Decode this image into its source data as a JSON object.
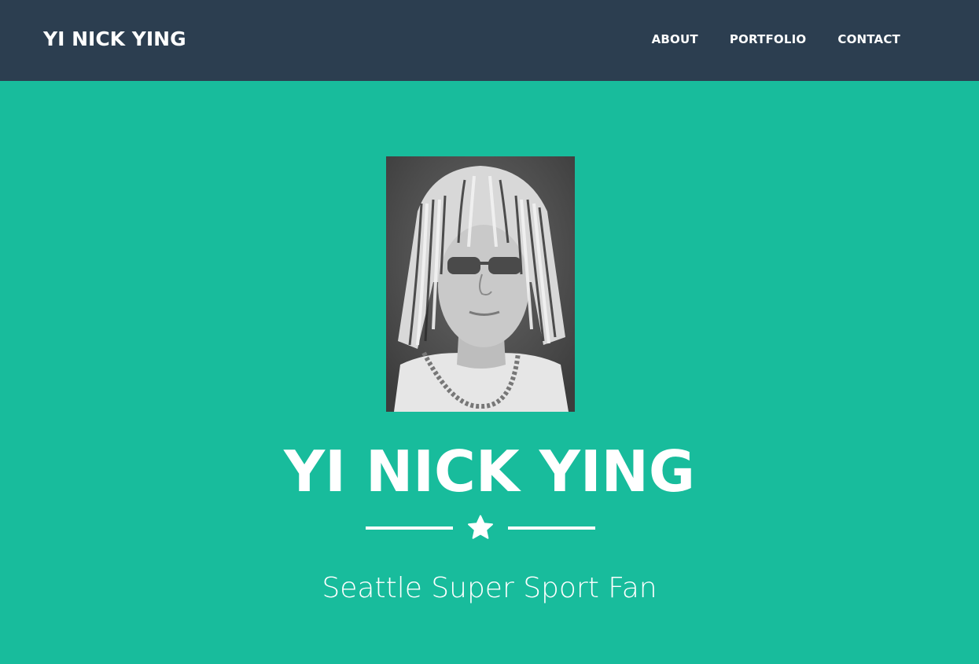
{
  "navbar": {
    "brand": "YI NICK YING",
    "links": [
      {
        "label": "ABOUT"
      },
      {
        "label": "PORTFOLIO"
      },
      {
        "label": "CONTACT"
      }
    ]
  },
  "hero": {
    "title": "YI NICK YING",
    "divider_icon": "star-icon",
    "subtitle": "Seattle Super Sport Fan",
    "profile_image": "profile-photo"
  },
  "colors": {
    "navbar_bg": "#2c3e50",
    "hero_bg": "#18bc9c",
    "text": "#ffffff"
  }
}
